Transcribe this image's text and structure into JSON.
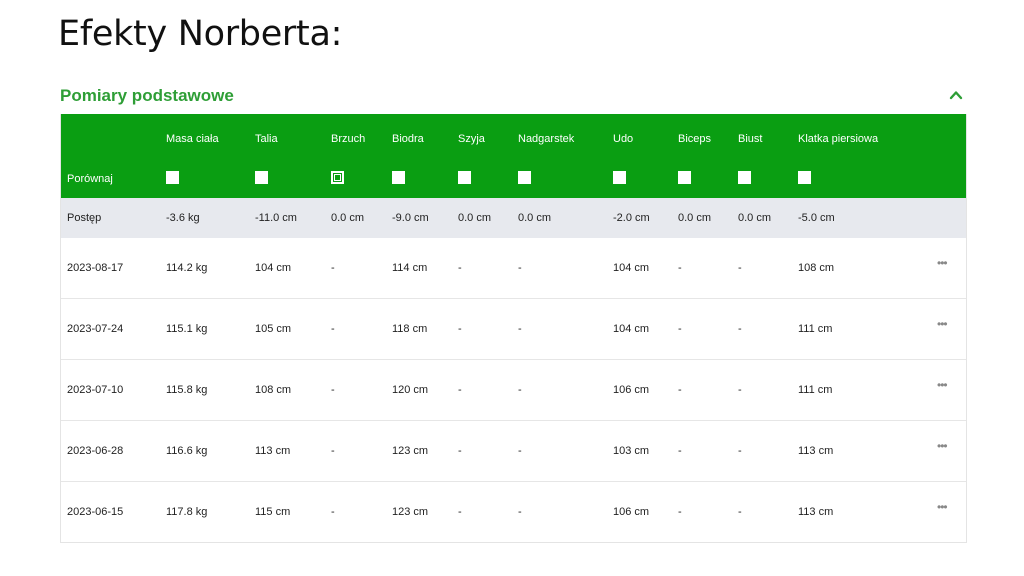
{
  "page": {
    "title": "Efekty Norberta:"
  },
  "section": {
    "title": "Pomiary podstawowe",
    "collapse_icon": "chevron-up-icon",
    "accent_color": "#2e9e36"
  },
  "table": {
    "header_bg": "#0a9e12",
    "columns": [
      "",
      "Masa ciała",
      "Talia",
      "Brzuch",
      "Biodra",
      "Szyja",
      "Nadgarstek",
      "Udo",
      "Biceps",
      "Biust",
      "Klatka piersiowa"
    ],
    "compare": {
      "label": "Porównaj",
      "checked": [
        false,
        false,
        true,
        false,
        false,
        false,
        false,
        false,
        false,
        false
      ]
    },
    "progress": {
      "label": "Postęp",
      "values": [
        "-3.6 kg",
        "-11.0 cm",
        "0.0 cm",
        "-9.0 cm",
        "0.0 cm",
        "0.0 cm",
        "-2.0 cm",
        "0.0 cm",
        "0.0 cm",
        "-5.0 cm"
      ]
    },
    "rows": [
      {
        "date": "2023-08-17",
        "values": [
          "114.2 kg",
          "104 cm",
          "-",
          "114 cm",
          "-",
          "-",
          "104 cm",
          "-",
          "-",
          "108 cm"
        ],
        "more": "•••"
      },
      {
        "date": "2023-07-24",
        "values": [
          "115.1 kg",
          "105 cm",
          "-",
          "118 cm",
          "-",
          "-",
          "104 cm",
          "-",
          "-",
          "111 cm"
        ],
        "more": "•••"
      },
      {
        "date": "2023-07-10",
        "values": [
          "115.8 kg",
          "108 cm",
          "-",
          "120 cm",
          "-",
          "-",
          "106 cm",
          "-",
          "-",
          "111 cm"
        ],
        "more": "•••"
      },
      {
        "date": "2023-06-28",
        "values": [
          "116.6 kg",
          "113 cm",
          "-",
          "123 cm",
          "-",
          "-",
          "103 cm",
          "-",
          "-",
          "113 cm"
        ],
        "more": "•••"
      },
      {
        "date": "2023-06-15",
        "values": [
          "117.8 kg",
          "115 cm",
          "-",
          "123 cm",
          "-",
          "-",
          "106 cm",
          "-",
          "-",
          "113 cm"
        ],
        "more": "•••"
      }
    ]
  }
}
